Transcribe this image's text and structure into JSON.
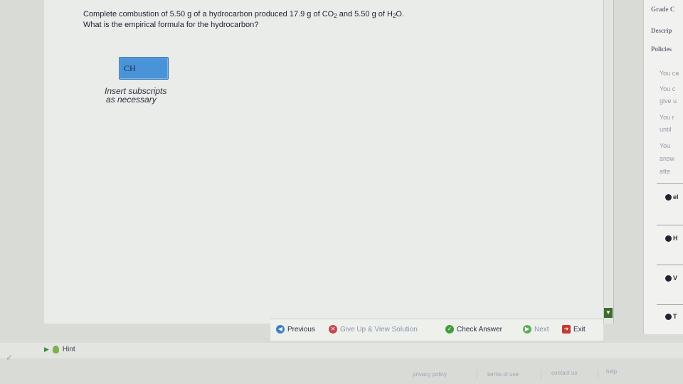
{
  "question": {
    "line1_a": "Complete combustion of 5.50 g of a hydrocarbon produced 17.9 g of CO",
    "line1_sub1": "2",
    "line1_b": " and 5.50 g of H",
    "line1_sub2": "2",
    "line1_c": "O.",
    "line2": "What is the empirical formula for the hydrocarbon?"
  },
  "answer": {
    "value": "CH"
  },
  "insert_note": {
    "line1": "Insert subscripts",
    "line2": "as necessary"
  },
  "buttons": {
    "previous": "Previous",
    "give_up": "Give Up & View Solution",
    "check": "Check Answer",
    "next": "Next",
    "exit": "Exit"
  },
  "hint": {
    "label": "Hint"
  },
  "footer": {
    "privacy": "privacy policy",
    "terms": "terms of use",
    "contact": "contact us",
    "help": "help"
  },
  "sidebar": {
    "grade": "Grade C",
    "description": "Descrip",
    "policies": "Policies",
    "t1": "You ca",
    "t2": "You c",
    "t3": "give u",
    "t4": "You r",
    "t5": "until",
    "t6": "You",
    "t7": "answ",
    "t8": "atte",
    "r1": "el",
    "r2": "H",
    "r3": "V",
    "r4": "T"
  },
  "colors": {
    "answer_box": "#4a93d8",
    "check": "#3f9d3a",
    "exit": "#c53a31"
  }
}
